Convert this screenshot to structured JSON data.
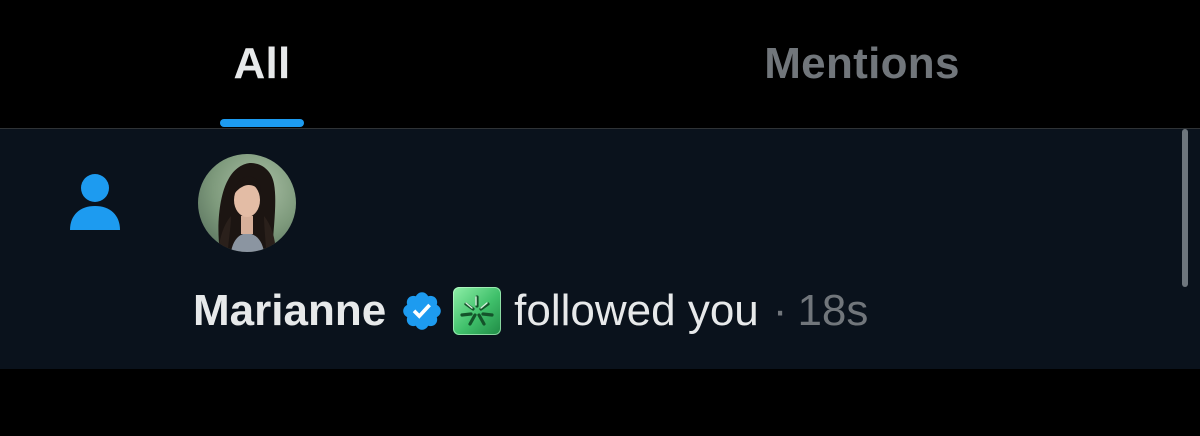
{
  "tabs": {
    "all_label": "All",
    "mentions_label": "Mentions",
    "active": "All"
  },
  "notification": {
    "type_icon": "person-icon",
    "user_name": "Marianne",
    "verified_icon": "verified-badge-icon",
    "affiliate_icon": "affiliate-badge-icon",
    "action": "followed you",
    "separator": "·",
    "time": "18s"
  },
  "colors": {
    "accent": "#1d9bf0",
    "background": "#000000",
    "row_background": "#0a121c",
    "primary_text": "#e7e9ea",
    "secondary_text": "#71767b"
  }
}
